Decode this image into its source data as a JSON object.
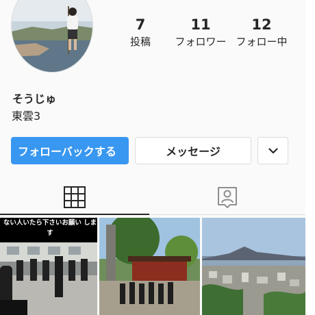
{
  "profile": {
    "username": "そうじゅ",
    "bio": "東雲3",
    "stats": [
      {
        "number": "7",
        "label": "投稿"
      },
      {
        "number": "11",
        "label": "フォロワー"
      },
      {
        "number": "12",
        "label": "フォロー中"
      }
    ]
  },
  "actions": {
    "follow_back_label": "フォローバックする",
    "message_label": "メッセージ",
    "more_icon": "chevron-down-icon"
  },
  "tabs": [
    {
      "name": "posts-grid",
      "icon": "grid-icon",
      "active": true
    },
    {
      "name": "tagged",
      "icon": "tagged-user-icon",
      "active": false
    }
  ],
  "posts": [
    {
      "caption": "ない人いたら下さいお願い します"
    },
    {
      "caption": ""
    },
    {
      "caption": ""
    }
  ],
  "colors": {
    "accent": "#3897f0",
    "text": "#262626",
    "border": "#dbdbdb",
    "background": "#fafafa"
  }
}
